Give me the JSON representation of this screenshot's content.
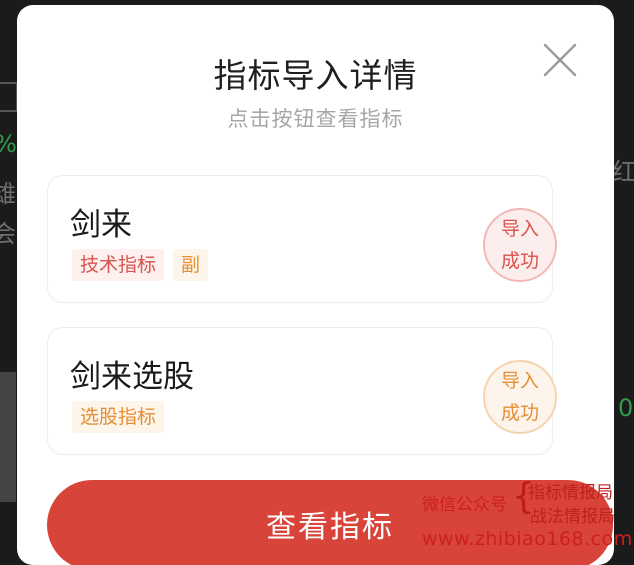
{
  "modal": {
    "title": "指标导入详情",
    "subtitle": "点击按钮查看指标",
    "close_icon": "close-icon",
    "items": [
      {
        "name": "剑来",
        "tags": [
          {
            "label": "技术指标",
            "color": "#d9534f"
          },
          {
            "label": "副",
            "color": "#e58f36"
          }
        ],
        "status_line1": "导入",
        "status_line2": "成功",
        "status_color": "#d9534f"
      },
      {
        "name": "剑来选股",
        "tags": [
          {
            "label": "选股指标",
            "color": "#e58f36"
          }
        ],
        "status_line1": "导入",
        "status_line2": "成功",
        "status_color": "#e58f36"
      }
    ],
    "primary_button": "查看指标",
    "accent_color": "#d9443a"
  },
  "background": {
    "fragments": [
      "红",
      "0",
      "%",
      "会",
      "雄"
    ]
  },
  "watermark": {
    "left_text": "微信公众号",
    "line1": "指标情报局",
    "line2": "战法情报局",
    "url": "www.zhibiao168.com"
  }
}
